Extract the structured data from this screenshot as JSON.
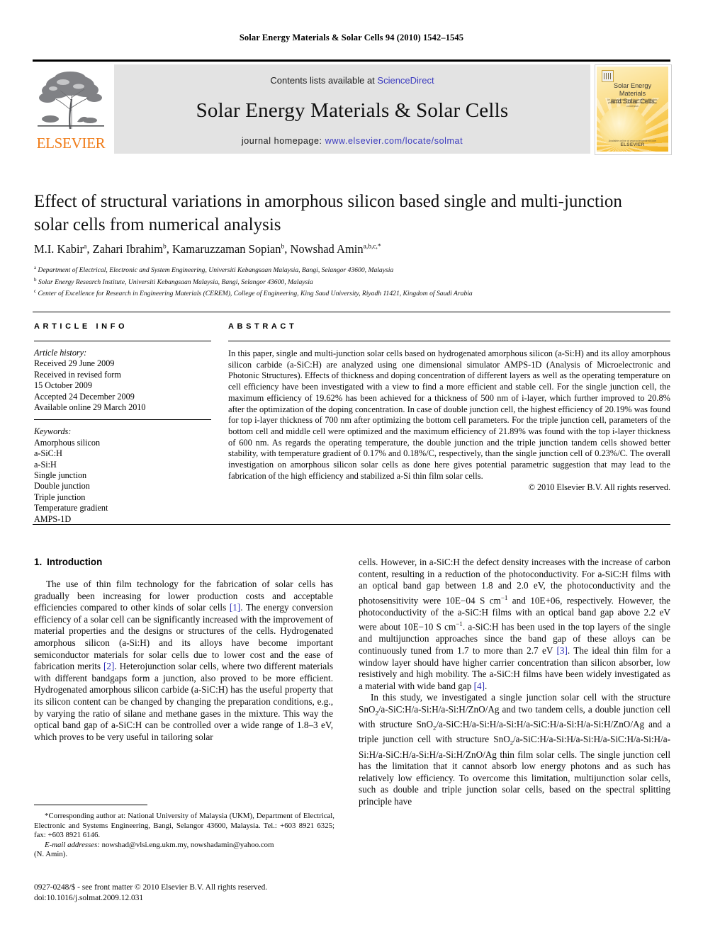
{
  "running_head": "Solar Energy Materials & Solar Cells 94 (2010) 1542–1545",
  "masthead": {
    "contents_prefix": "Contents lists available at ",
    "sciencedirect": "ScienceDirect",
    "journal_title": "Solar Energy Materials & Solar Cells",
    "homepage_prefix": "journal homepage: ",
    "homepage_url": "www.elsevier.com/locate/solmat",
    "publisher": "ELSEVIER",
    "link_color": "#3b3bbf",
    "publisher_color": "#f07d1a"
  },
  "cover": {
    "title_line1": "Solar Energy Materials",
    "title_line2": "and Solar Cells",
    "subtitle": "An international journal devoted to photovoltaic, photothermal and photochemical solar energy conversion",
    "footer_brand": "ELSEVIER",
    "footer_note": "Available online at www.sciencedirect.com"
  },
  "article": {
    "title": "Effect of structural variations in amorphous silicon based single and multi-junction solar cells from numerical analysis",
    "authors": [
      {
        "name": "M.I. Kabir",
        "marks": "a"
      },
      {
        "name": "Zahari Ibrahim",
        "marks": "b"
      },
      {
        "name": "Kamaruzzaman Sopian",
        "marks": "b"
      },
      {
        "name": "Nowshad Amin",
        "marks": "a,b,c,*"
      }
    ],
    "affiliations": [
      {
        "mark": "a",
        "text": "Department of Electrical, Electronic and System Engineering, Universiti Kebangsaan Malaysia, Bangi, Selangor 43600, Malaysia"
      },
      {
        "mark": "b",
        "text": "Solar Energy Research Institute, Universiti Kebangsaan Malaysia, Bangi, Selangor 43600, Malaysia"
      },
      {
        "mark": "c",
        "text": "Center of Excellence for Research in Engineering Materials (CEREM), College of Engineering, King Saud University, Riyadh 11421, Kingdom of Saudi Arabia"
      }
    ]
  },
  "article_info": {
    "heading": "ARTICLE INFO",
    "history_label": "Article history:",
    "history": [
      "Received 29 June 2009",
      "Received in revised form",
      "15 October 2009",
      "Accepted 24 December 2009",
      "Available online 29 March 2010"
    ],
    "keywords_label": "Keywords:",
    "keywords": [
      "Amorphous silicon",
      "a-SiC:H",
      "a-Si:H",
      "Single junction",
      "Double junction",
      "Triple junction",
      "Temperature gradient",
      "AMPS-1D"
    ]
  },
  "abstract": {
    "heading": "ABSTRACT",
    "body": "In this paper, single and multi-junction solar cells based on hydrogenated amorphous silicon (a-Si:H) and its alloy amorphous silicon carbide (a-SiC:H) are analyzed using one dimensional simulator AMPS-1D (Analysis of Microelectronic and Photonic Structures). Effects of thickness and doping concentration of different layers as well as the operating temperature on cell efficiency have been investigated with a view to find a more efficient and stable cell. For the single junction cell, the maximum efficiency of 19.62% has been achieved for a thickness of 500 nm of i-layer, which further improved to 20.8% after the optimization of the doping concentration. In case of double junction cell, the highest efficiency of 20.19% was found for top i-layer thickness of 700 nm after optimizing the bottom cell parameters. For the triple junction cell, parameters of the bottom cell and middle cell were optimized and the maximum efficiency of 21.89% was found with the top i-layer thickness of 600 nm. As regards the operating temperature, the double junction and the triple junction tandem cells showed better stability, with temperature gradient of 0.17% and 0.18%/C, respectively, than the single junction cell of 0.23%/C. The overall investigation on amorphous silicon solar cells as done here gives potential parametric suggestion that may lead to the fabrication of the high efficiency and stabilized a-Si thin film solar cells.",
    "copyright": "© 2010 Elsevier B.V. All rights reserved."
  },
  "body": {
    "section_number": "1.",
    "section_title": "Introduction",
    "left_paragraph_1_a": "The use of thin film technology for the fabrication of solar cells has gradually been increasing for lower production costs and acceptable efficiencies compared to other kinds of solar cells ",
    "left_cite_1": "[1]",
    "left_paragraph_1_b": ". The energy conversion efficiency of a solar cell can be significantly increased with the improvement of material properties and the designs or structures of the cells. Hydrogenated amorphous silicon (a-Si:H) and its alloys have become important semiconductor materials for solar cells due to lower cost and the ease of fabrication merits ",
    "left_cite_2": "[2]",
    "left_paragraph_1_c": ". Heterojunction solar cells, where two different materials with different bandgaps form a junction, also proved to be more efficient. Hydrogenated amorphous silicon carbide (a-SiC:H) has the useful property that its silicon content can be changed by changing the preparation conditions, e.g., by varying the ratio of silane and methane gases in the mixture. This way the optical band gap of a-SiC:H can be controlled over a wide range of 1.8–3 eV, which proves to be very useful in tailoring solar",
    "right_paragraph_1_a": "cells. However, in a-SiC:H the defect density increases with the increase of carbon content, resulting in a reduction of the photoconductivity. For a-SiC:H films with an optical band gap between 1.8 and 2.0 eV, the photoconductivity and the photosensitivity were 10E−04 S cm",
    "right_exp_1": "−1",
    "right_paragraph_1_b": " and 10E+06, respectively. However, the photoconductivity of the a-SiC:H films with an optical band gap above 2.2 eV were about 10E−10 S cm",
    "right_exp_2": "−1",
    "right_paragraph_1_c": ". a-SiC:H has been used in the top layers of the single and multijunction approaches since the band gap of these alloys can be continuously tuned from 1.7 to more than 2.7 eV ",
    "right_cite_3": "[3]",
    "right_paragraph_1_d": ". The ideal thin film for a window layer should have higher carrier concentration than silicon absorber, low resistively and high mobility. The a-SiC:H films have been widely investigated as a material with wide band gap ",
    "right_cite_4": "[4]",
    "right_paragraph_1_e": ".",
    "right_paragraph_2_a": "In this study, we investigated a single junction solar cell with the structure SnO",
    "right_sub_1": "2",
    "right_paragraph_2_b": "/a-SiC:H/a-Si:H/a-Si:H/ZnO/Ag and two tandem cells, a double junction cell with structure SnO",
    "right_sub_2": "2",
    "right_paragraph_2_c": "/a-SiC:H/a-Si:H/a-Si:H/a-SiC:H/a-Si:H/a-Si:H/ZnO/Ag and a triple junction cell with structure SnO",
    "right_sub_3": "2",
    "right_paragraph_2_d": "/a-SiC:H/a-Si:H/a-Si:H/a-SiC:H/a-Si:H/a-Si:H/a-SiC:H/a-Si:H/a-Si:H/ZnO/Ag thin film solar cells. The single junction cell has the limitation that it cannot absorb low energy photons and as such has relatively low efficiency. To overcome this limitation, multijunction solar cells, such as double and triple junction solar cells, based on the spectral splitting principle have"
  },
  "footnotes": {
    "corresponding": "Corresponding author at: National University of Malaysia (UKM), Department of Electrical, Electronic and Systems Engineering, Bangi, Selangor 43600, Malaysia. Tel.: +603 8921 6325; fax: +603 8921 6146.",
    "email_label": "E-mail addresses:",
    "emails": "nowshad@vlsi.eng.ukm.my, nowshadamin@yahoo.com",
    "email_owner": "(N. Amin).",
    "issn_line": "0927-0248/$ - see front matter © 2010 Elsevier B.V. All rights reserved.",
    "doi_line": "doi:10.1016/j.solmat.2009.12.031"
  }
}
